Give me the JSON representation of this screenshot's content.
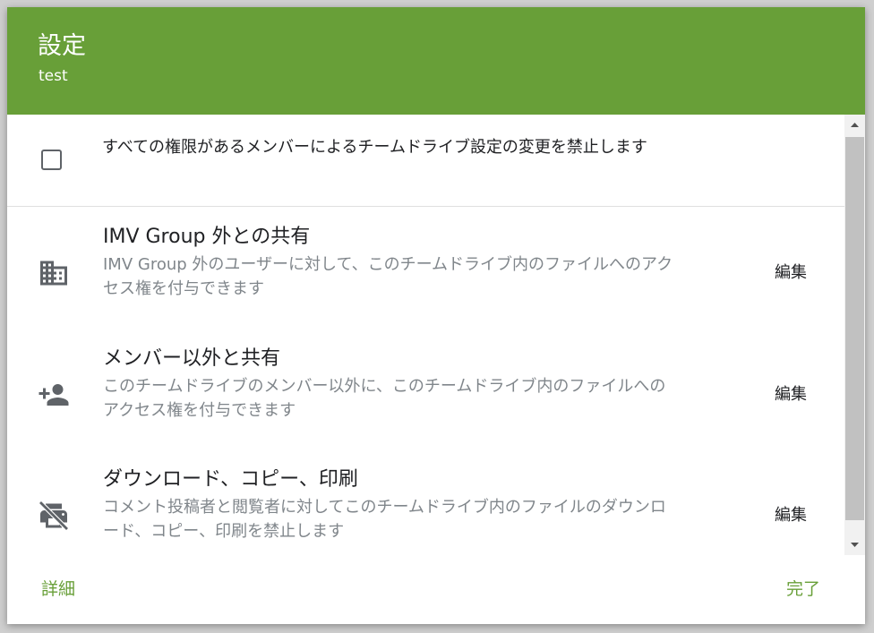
{
  "dialog": {
    "title": "設定",
    "subtitle": "test"
  },
  "restrict_setting": {
    "checked": false,
    "label": "すべての権限があるメンバーによるチームドライブ設定の変更を禁止します"
  },
  "settings": [
    {
      "icon": "domain-icon",
      "title": "IMV Group 外との共有",
      "description": "IMV Group 外のユーザーに対して、このチームドライブ内のファイルへのアクセス権を付与できます",
      "edit_label": "編集"
    },
    {
      "icon": "person-add-icon",
      "title": "メンバー以外と共有",
      "description": "このチームドライブのメンバー以外に、このチームドライブ内のファイルへのアクセス権を付与できます",
      "edit_label": "編集"
    },
    {
      "icon": "print-disabled-icon",
      "title": "ダウンロード、コピー、印刷",
      "description": "コメント投稿者と閲覧者に対してこのチームドライブ内のファイルのダウンロード、コピー、印刷を禁止します",
      "edit_label": "編集"
    }
  ],
  "footer": {
    "details_label": "詳細",
    "done_label": "完了"
  },
  "colors": {
    "header": "#689f38",
    "accent": "#689f38"
  }
}
